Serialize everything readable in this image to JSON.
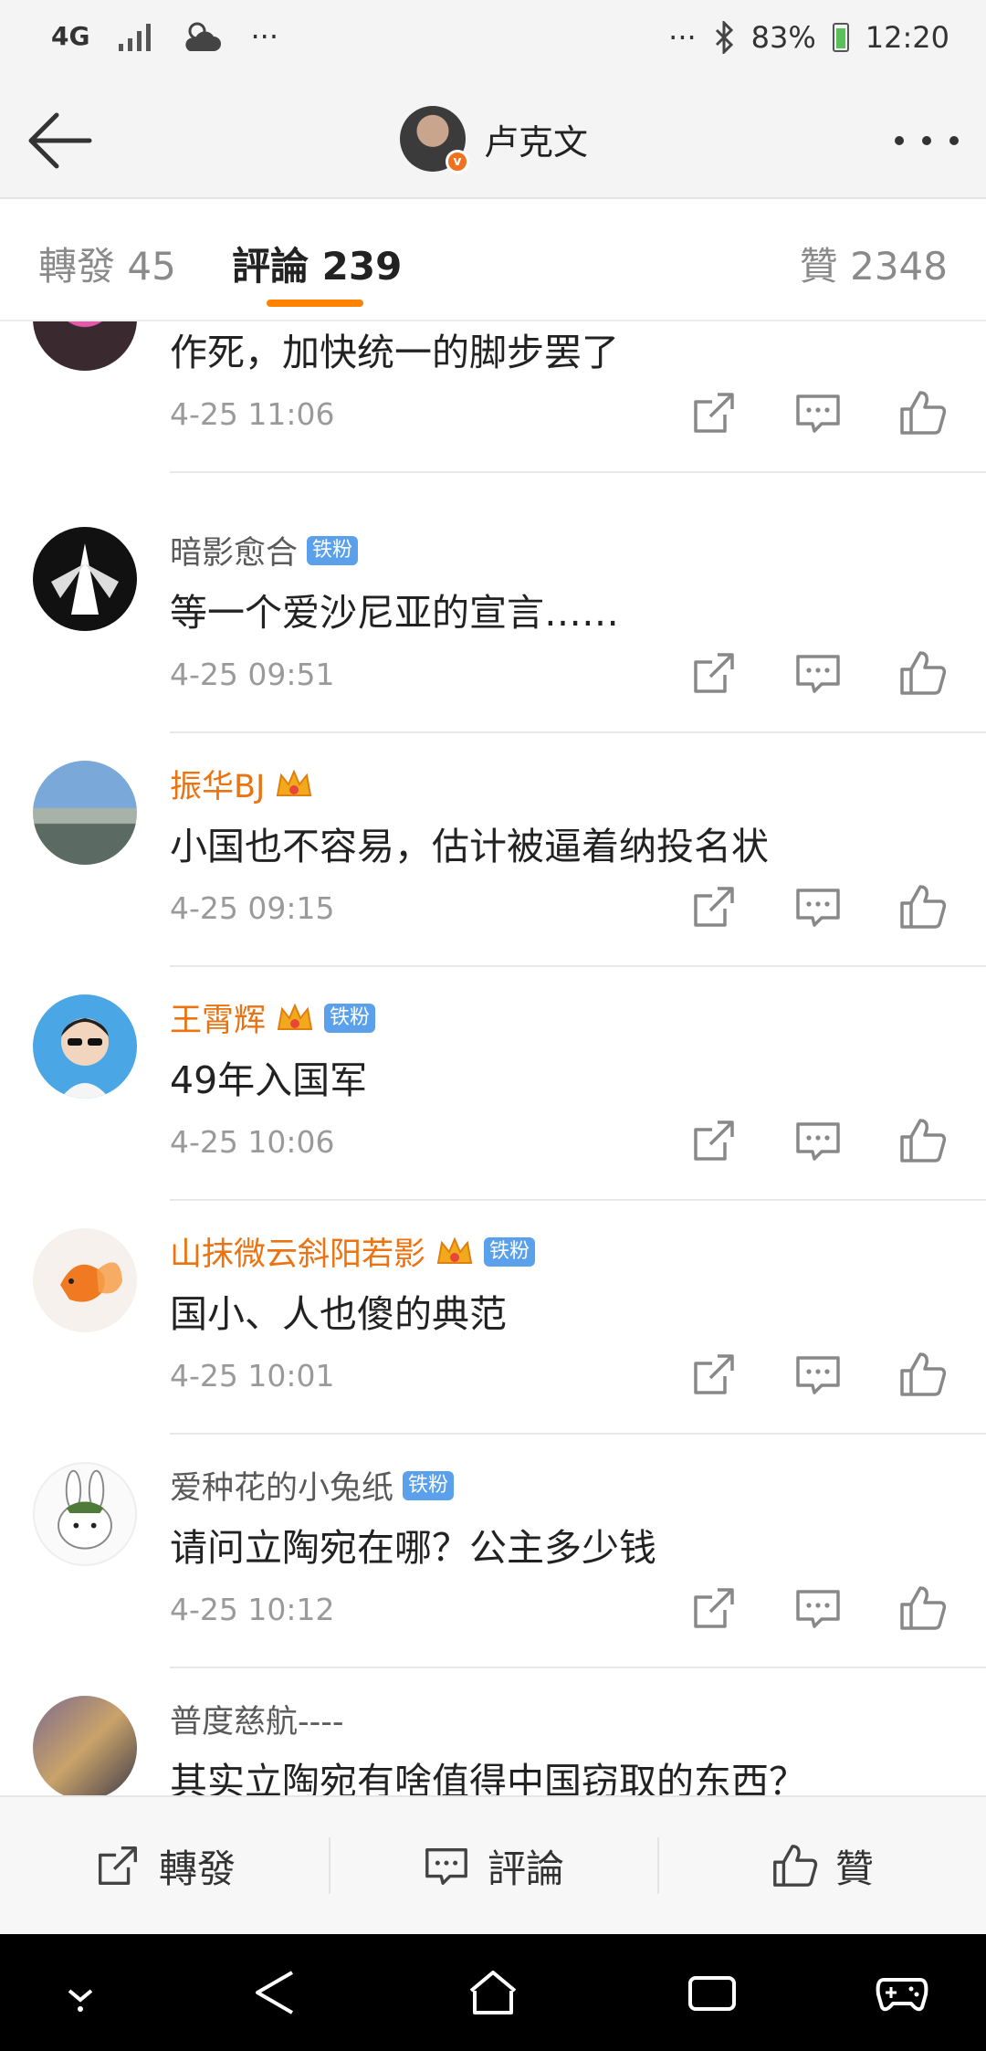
{
  "status_bar": {
    "network": "4G",
    "dots_left": "···",
    "dots_right": "···",
    "battery": "83%",
    "time": "12:20"
  },
  "header": {
    "title": "卢克文"
  },
  "tabs": {
    "forward": "轉發 45",
    "comments": "評論 239",
    "likes": "贊 2348"
  },
  "comments": [
    {
      "user": "",
      "content": "作死，加快统一的脚步罢了",
      "time": "4-25 11:06"
    },
    {
      "user": "暗影愈合",
      "badge": "铁粉",
      "content": "等一个爱沙尼亚的宣言……",
      "time": "4-25 09:51"
    },
    {
      "user": "振华BJ",
      "content": "小国也不容易，估计被逼着纳投名状",
      "time": "4-25 09:15"
    },
    {
      "user": "王霄辉",
      "badge": "铁粉",
      "content": "49年入国军",
      "time": "4-25 10:06"
    },
    {
      "user": "山抹微云斜阳若影",
      "badge": "铁粉",
      "content": "国小、人也傻的典范",
      "time": "4-25 10:01"
    },
    {
      "user": "爱种花的小兔纸",
      "badge": "铁粉",
      "content": "请问立陶宛在哪？公主多少钱",
      "time": "4-25 10:12"
    },
    {
      "user": "普度慈航----",
      "content": "其实立陶宛有啥值得中国窃取的东西？"
    }
  ],
  "toolbar": {
    "forward": "轉發",
    "comment": "評論",
    "like": "贊"
  },
  "colors": {
    "accent": "#ff8200",
    "vip_name": "#eb7311",
    "fan_badge": "#5aa0ea"
  }
}
